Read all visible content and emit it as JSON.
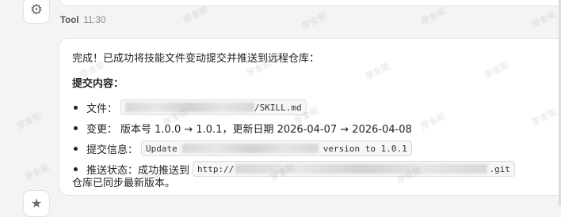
{
  "message": {
    "sender": "Tool",
    "time": "11:30",
    "summary": "完成！已成功将技能文件变动提交并推送到远程仓库：",
    "heading": "提交内容：",
    "items": [
      {
        "label": "文件：",
        "code_suffix": "/SKILL.md"
      },
      {
        "label": "变更：",
        "text": "版本号 1.0.0 → 1.0.1，更新日期 2026-04-07 → 2026-04-08"
      },
      {
        "label": "提交信息：",
        "code_prefix": "Update",
        "code_suffix": "version to 1.0.1"
      },
      {
        "label": "推送状态：成功推送到",
        "code_prefix": "http://",
        "code_suffix": ".git"
      }
    ],
    "footer": "仓库已同步最新版本。"
  },
  "watermark": "廖金能",
  "icons": {
    "top_avatar": "gear-icon",
    "bottom_avatar": "star-icon"
  },
  "colors": {
    "background": "#f4f4f4",
    "card": "#ffffff",
    "code_bg": "#f6f6f6"
  }
}
